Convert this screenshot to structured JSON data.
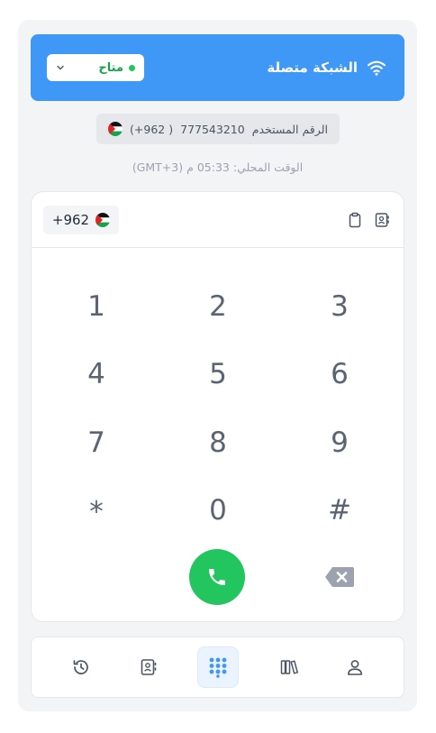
{
  "header": {
    "network_status": "الشبكة متصلة",
    "availability": "متاح",
    "icons": {
      "network": "wifi-icon",
      "dropdown": "chevron-down-icon"
    },
    "colors": {
      "bar": "#3f97f6",
      "available": "#22c55e"
    }
  },
  "user": {
    "label": "الرقم المستخدم",
    "number": "777543210",
    "country_code": "( 962+)",
    "flag": "jordan-flag-icon"
  },
  "local_time": {
    "label": "الوقت المحلي:",
    "value": "05:33 م",
    "timezone": "(GMT+3)"
  },
  "dialer": {
    "country_code": "+962",
    "flag": "jordan-flag-icon",
    "icons": {
      "contacts": "address-book-icon",
      "paste": "clipboard-icon",
      "call": "phone-icon",
      "delete": "backspace-icon"
    },
    "keys": [
      "1",
      "2",
      "3",
      "4",
      "5",
      "6",
      "7",
      "8",
      "9",
      "*",
      "0",
      "#"
    ],
    "call_color": "#22c55e"
  },
  "nav": {
    "items": [
      "profile-icon",
      "books-icon",
      "dialpad-icon",
      "contacts-icon",
      "history-icon"
    ],
    "active": "dialpad-icon"
  }
}
